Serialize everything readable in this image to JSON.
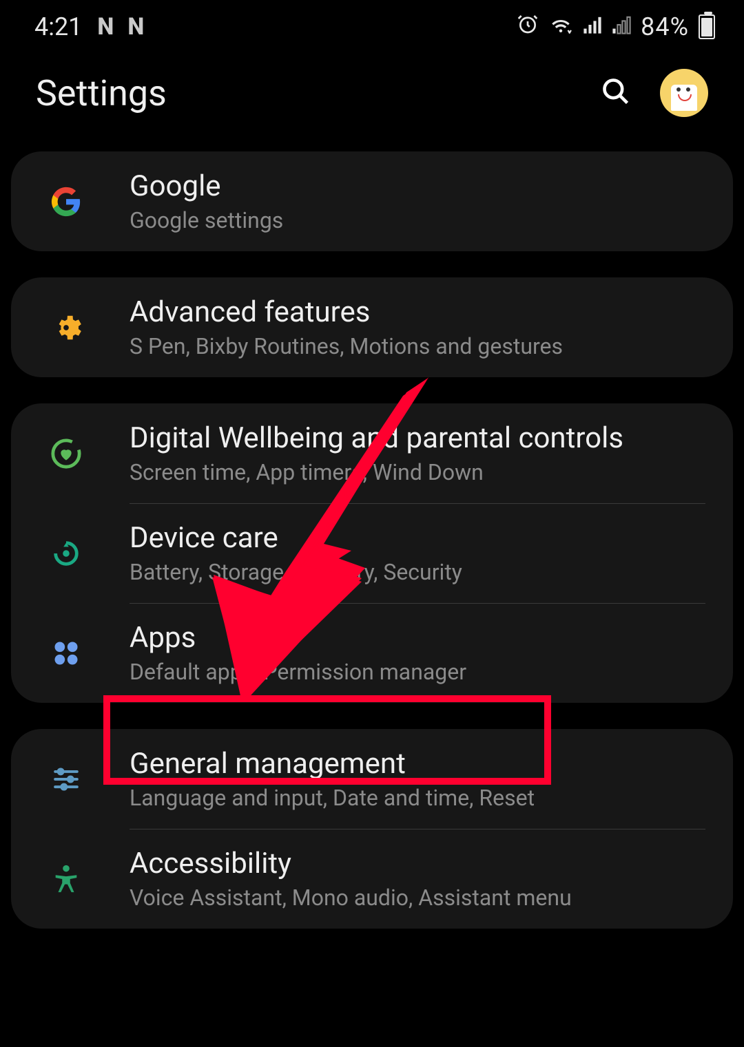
{
  "status": {
    "time": "4:21",
    "notif_icons": [
      "N",
      "N"
    ],
    "battery_percent": "84%"
  },
  "header": {
    "title": "Settings"
  },
  "groups": [
    {
      "items": [
        {
          "icon": "google",
          "title": "Google",
          "subtitle": "Google settings"
        }
      ]
    },
    {
      "items": [
        {
          "icon": "gear",
          "title": "Advanced features",
          "subtitle": "S Pen, Bixby Routines, Motions and gestures"
        }
      ]
    },
    {
      "items": [
        {
          "icon": "heart-circle",
          "title": "Digital Wellbeing and parental controls",
          "subtitle": "Screen time, App timers, Wind Down"
        },
        {
          "icon": "refresh-circle",
          "title": "Device care",
          "subtitle": "Battery, Storage, Memory, Security"
        },
        {
          "icon": "apps-grid",
          "title": "Apps",
          "subtitle": "Default apps, Permission manager"
        }
      ]
    },
    {
      "items": [
        {
          "icon": "sliders",
          "title": "General management",
          "subtitle": "Language and input, Date and time, Reset"
        },
        {
          "icon": "accessibility",
          "title": "Accessibility",
          "subtitle": "Voice Assistant, Mono audio, Assistant menu"
        }
      ]
    }
  ],
  "annotation": {
    "target": "General management",
    "arrow": true,
    "highlight": true
  },
  "icon_colors": {
    "google": "#4284F4",
    "gear": "#F7AE2A",
    "heart-circle": "#5CBB5A",
    "refresh-circle": "#1AA983",
    "apps-grid": "#6E9FEE",
    "sliders": "#5E9BC4",
    "accessibility": "#29A36B"
  }
}
